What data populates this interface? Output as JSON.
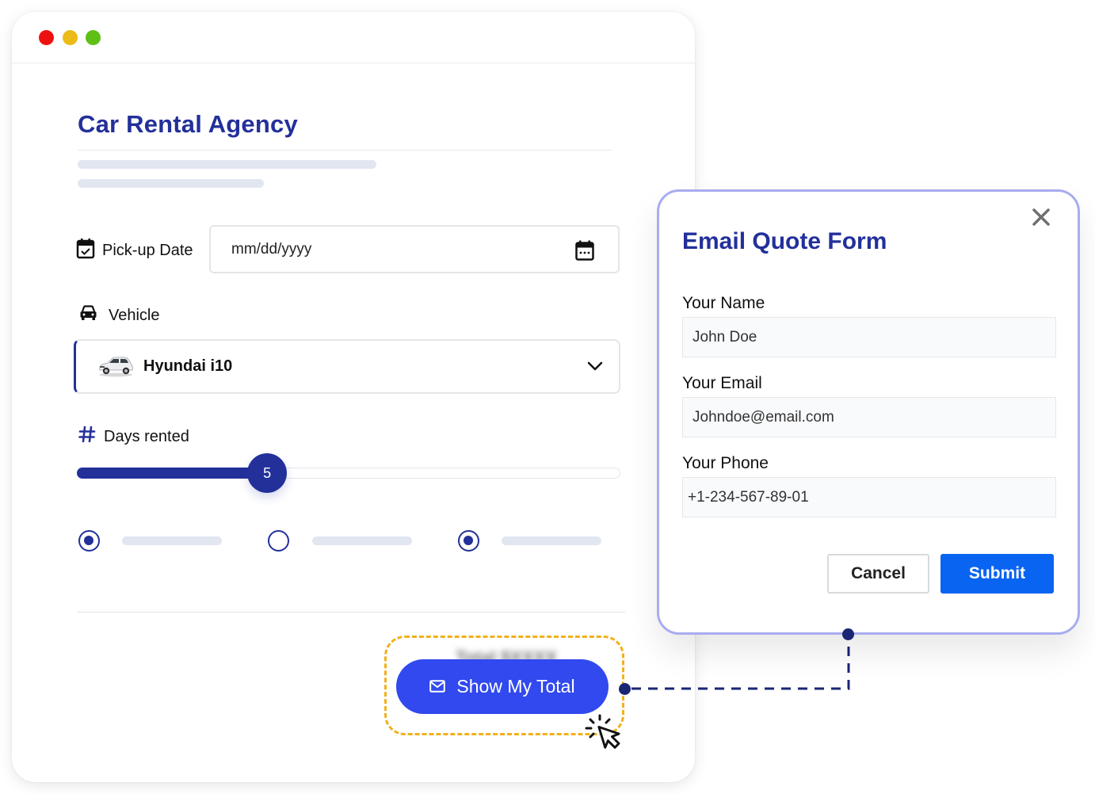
{
  "window": {
    "traffic_lights": [
      "close",
      "minimize",
      "maximize"
    ]
  },
  "app": {
    "title": "Car Rental Agency"
  },
  "form": {
    "pickup_date": {
      "label": "Pick-up Date",
      "icon": "calendar-check-icon",
      "placeholder": "mm/dd/yyyy",
      "picker_icon": "calendar-icon"
    },
    "vehicle": {
      "label": "Vehicle",
      "icon": "car-icon",
      "selected": "Hyundai i10",
      "thumbnail": "hatchback-car-image",
      "dropdown_icon": "chevron-down-icon"
    },
    "days": {
      "label": "Days rented",
      "icon": "hash-icon",
      "value": "5",
      "fill_fraction": 0.35
    },
    "radios": [
      {
        "checked": true
      },
      {
        "checked": false
      },
      {
        "checked": true
      }
    ],
    "show_total_button": {
      "label": "Show My Total",
      "icon": "mail-icon",
      "blurred_total": "Total $XXXX"
    }
  },
  "modal": {
    "title": "Email Quote Form",
    "close_icon": "close-icon",
    "fields": [
      {
        "label": "Your Name",
        "value": "John Doe"
      },
      {
        "label": "Your Email",
        "value": "Johndoe@email.com"
      },
      {
        "label": "Your Phone",
        "value": "+1-234-567-89-01"
      }
    ],
    "cancel_label": "Cancel",
    "submit_label": "Submit"
  },
  "colors": {
    "brand_navy": "#23309a",
    "button_blue": "#3149ee",
    "submit_blue": "#0a64f2",
    "highlight_yellow": "#f1b11b",
    "modal_border": "#a8acef",
    "connector": "#1a2574"
  }
}
